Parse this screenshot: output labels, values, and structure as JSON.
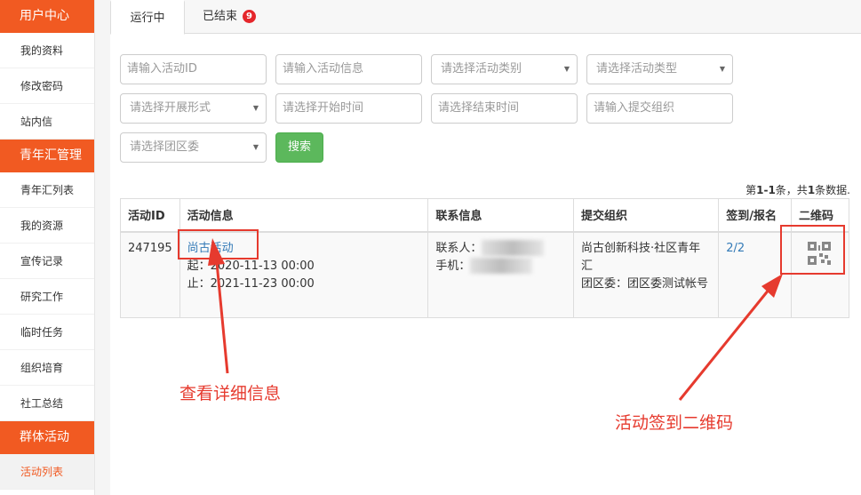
{
  "sidebar": {
    "sections": [
      {
        "title": "用户中心",
        "items": [
          "我的资料",
          "修改密码",
          "站内信"
        ]
      },
      {
        "title": "青年汇管理",
        "items": [
          "青年汇列表",
          "我的资源",
          "宣传记录",
          "研究工作",
          "临时任务",
          "组织培育",
          "社工总结"
        ]
      },
      {
        "title": "群体活动",
        "items": [
          "活动列表"
        ]
      }
    ],
    "active_item": "活动列表"
  },
  "tabs": {
    "running": "运行中",
    "ended": "已结束",
    "ended_badge": "9"
  },
  "filters": {
    "activity_id": "请输入活动ID",
    "activity_info": "请输入活动信息",
    "activity_category": "请选择活动类别",
    "activity_type": "请选择活动类型",
    "form": "请选择开展形式",
    "start_time": "请选择开始时间",
    "end_time": "请选择结束时间",
    "submit_org": "请输入提交组织",
    "district": "请选择团区委",
    "search_button": "搜索"
  },
  "summary": {
    "prefix": "第",
    "range": "1-1",
    "middle": "条，共",
    "total": "1",
    "suffix": "条数据."
  },
  "table": {
    "headers": [
      "活动ID",
      "活动信息",
      "联系信息",
      "提交组织",
      "签到/报名",
      "二维码"
    ],
    "rows": [
      {
        "id": "247195",
        "name": "尚古活动",
        "start": "起：2020-11-13 00:00",
        "end": "止：2021-11-23 00:00",
        "contact_label": "联系人：",
        "phone_label": "手机：",
        "org": "尚古创新科技·社区青年汇",
        "district": "团区委：团区委测试帐号",
        "signin": "2/2"
      }
    ]
  },
  "annotations": {
    "detail": "查看详细信息",
    "qrcode": "活动签到二维码",
    "color": "#e63a2e"
  }
}
